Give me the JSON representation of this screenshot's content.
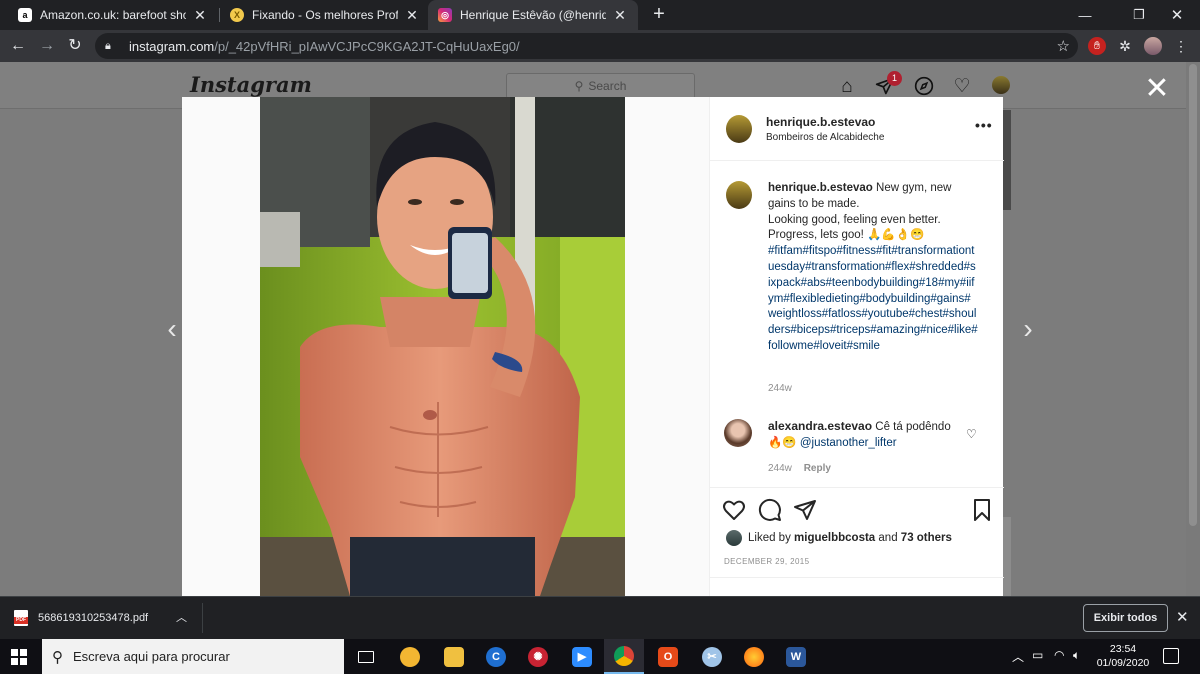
{
  "browser": {
    "tabs": [
      {
        "title": "Amazon.co.uk: barefoot shoes",
        "favicon": "amazon-icon",
        "active": false
      },
      {
        "title": "Fixando - Os melhores Profissionais",
        "favicon": "fixando-icon",
        "active": false
      },
      {
        "title": "Henrique Estêvão (@henrique.b.estevao)",
        "favicon": "instagram-icon",
        "active": true
      }
    ],
    "url_host": "instagram.com",
    "url_path": "/p/_42pVfHRi_pIAwVCJPcC9KGA2JT-CqHuUaxEg0/"
  },
  "instagram": {
    "logo": "Instagram",
    "search_placeholder": "Search",
    "notification_count": "1"
  },
  "post": {
    "username": "henrique.b.estevao",
    "location": "Bombeiros de Alcabideche",
    "caption_line1": "New gym, new gains to be made.",
    "caption_line2": "Looking good, feeling even better.",
    "caption_line3": "Progress, lets goo! 🙏💪👌😁",
    "hashtags": "#fitfam#fitspo#fitness#fit#transformationtuesday#transformation#flex#shredded#sixpack#abs#teenbodybuilding#18#my#iifym#flexibledieting#bodybuilding#gains#weightloss#fatloss#youtube#chest#shoulders#biceps#triceps#amazing#nice#like#followme#loveit#smile",
    "caption_time": "244w",
    "comment": {
      "username": "alexandra.estevao",
      "text": "Cê tá podêndo",
      "emoji": "🔥😁",
      "mention": "@justanother_lifter",
      "time": "244w",
      "reply_label": "Reply"
    },
    "liked_by_prefix": "Liked by",
    "liked_by_user": "miguelbbcosta",
    "liked_by_and": "and",
    "liked_by_others": "73 others",
    "date": "DECEMBER 29, 2015"
  },
  "downloads": {
    "file_name": "568619310253478.pdf",
    "show_all_label": "Exibir todos"
  },
  "taskbar": {
    "search_placeholder": "Escreva aqui para procurar",
    "time": "23:54",
    "date": "01/09/2020"
  }
}
